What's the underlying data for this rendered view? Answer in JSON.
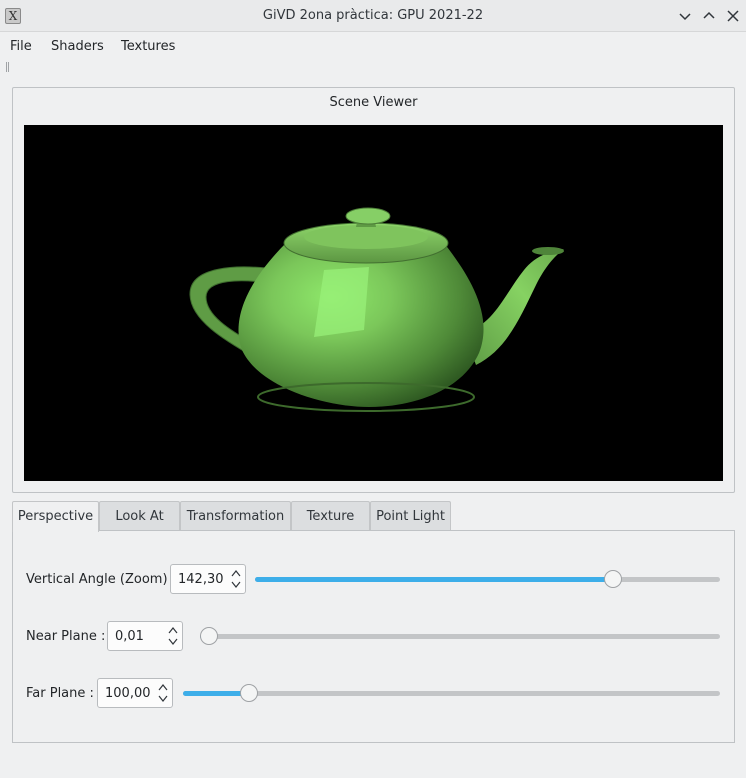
{
  "window": {
    "title": "GiVD 2ona pràctica: GPU 2021-22",
    "app_icon": "x-app-icon",
    "controls": [
      "minimize-icon",
      "maximize-icon",
      "close-icon"
    ]
  },
  "menubar": {
    "items": [
      "File",
      "Shaders",
      "Textures"
    ]
  },
  "scene_viewer": {
    "title": "Scene Viewer",
    "object": "teapot",
    "background_color": "#000000",
    "object_color": "#6fbf4a"
  },
  "tabs": {
    "items": [
      "Perspective",
      "Look At",
      "Transformation",
      "Texture",
      "Point Light"
    ],
    "active": "Perspective"
  },
  "perspective": {
    "vertical_angle": {
      "label": "Vertical Angle (Zoom) :",
      "value": "142,30",
      "slider_fraction": 0.78
    },
    "near_plane": {
      "label": "Near Plane :",
      "value": "0,01",
      "slider_fraction": 0.0
    },
    "far_plane": {
      "label": "Far Plane :",
      "value": "100,00",
      "slider_fraction": 0.11
    }
  },
  "colors": {
    "accent": "#3daee9",
    "window_bg": "#eff0f1"
  }
}
